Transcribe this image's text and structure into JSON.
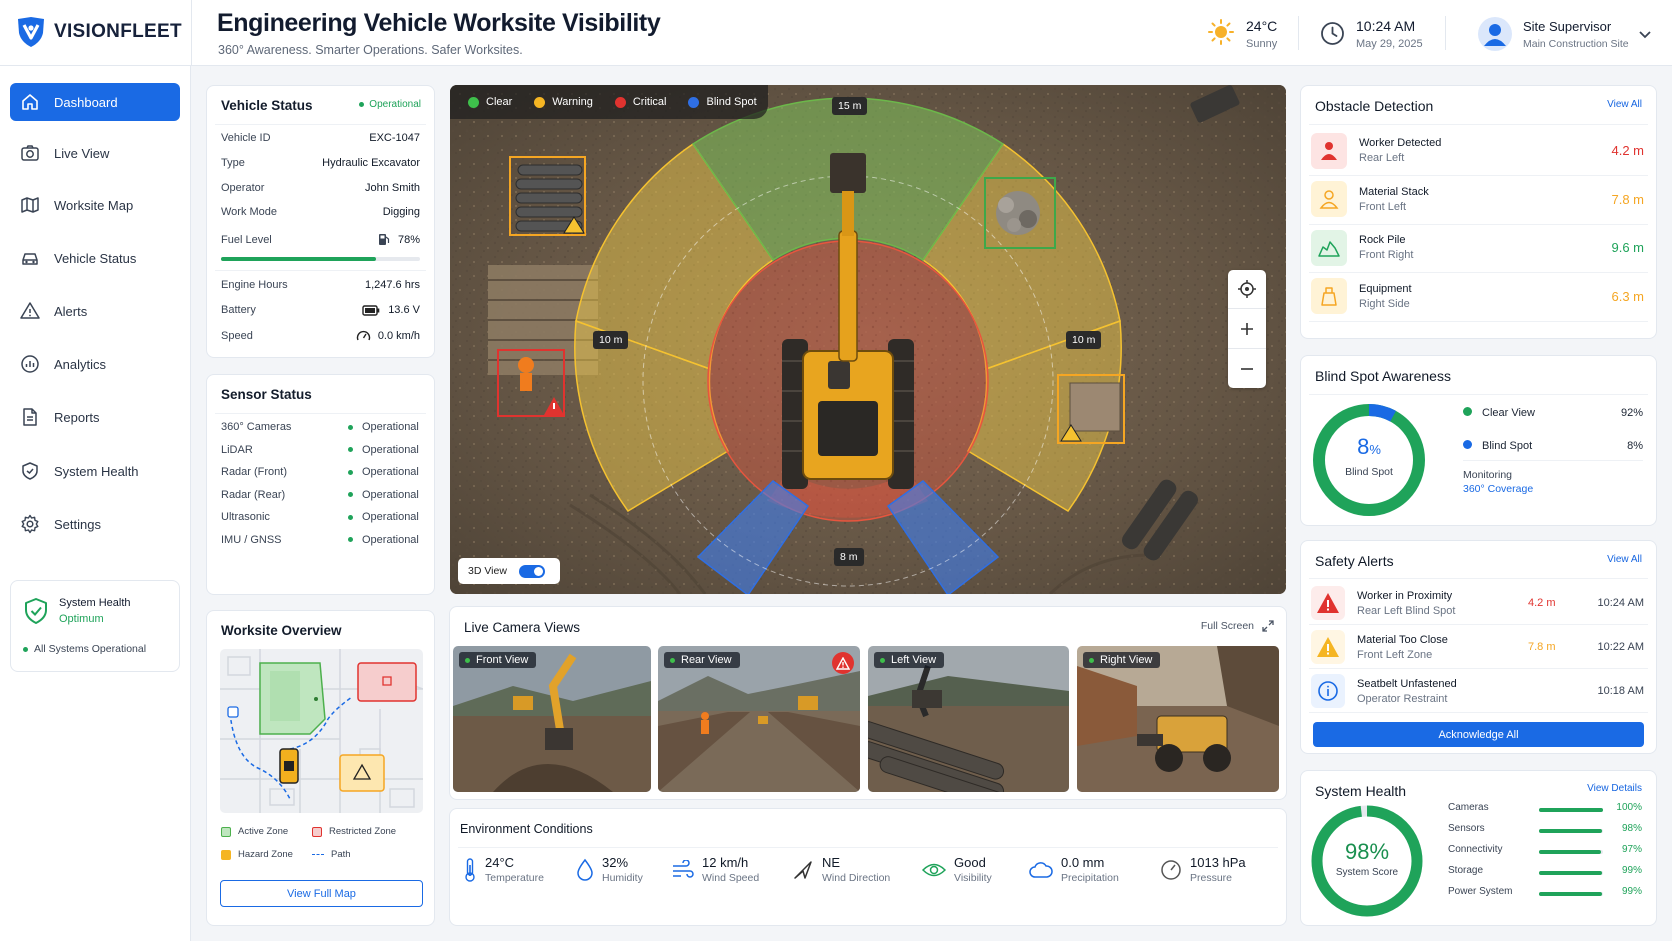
{
  "brand": {
    "name": "VISIONFLEET"
  },
  "header": {
    "title": "Engineering Vehicle Worksite Visibility",
    "subtitle": "360° Awareness. Smarter Operations. Safer Worksites.",
    "weather_temp": "24°C",
    "weather_desc": "Sunny",
    "time": "10:24 AM",
    "date": "May 29, 2025",
    "user_role": "Site Supervisor",
    "user_site": "Main Construction Site"
  },
  "nav": [
    {
      "label": "Dashboard",
      "icon": "home-icon",
      "active": true
    },
    {
      "label": "Live View",
      "icon": "camera-icon"
    },
    {
      "label": "Worksite Map",
      "icon": "map-icon"
    },
    {
      "label": "Vehicle Status",
      "icon": "car-icon"
    },
    {
      "label": "Alerts",
      "icon": "warning-icon"
    },
    {
      "label": "Analytics",
      "icon": "chart-icon"
    },
    {
      "label": "Reports",
      "icon": "document-icon"
    },
    {
      "label": "System Health",
      "icon": "shield-icon"
    },
    {
      "label": "Settings",
      "icon": "gear-icon"
    }
  ],
  "side_health": {
    "title": "System Health",
    "status": "Optimum",
    "note": "All Systems Operational"
  },
  "vehicle": {
    "title": "Vehicle Status",
    "status": "Operational",
    "rows": [
      {
        "k": "Vehicle ID",
        "v": "EXC-1047"
      },
      {
        "k": "Type",
        "v": "Hydraulic Excavator"
      },
      {
        "k": "Operator",
        "v": "John Smith"
      },
      {
        "k": "Work Mode",
        "v": "Digging"
      }
    ],
    "fuel_label": "Fuel Level",
    "fuel_value": "78%",
    "fuel_fraction": 0.78,
    "rows2": [
      {
        "k": "Engine Hours",
        "v": "1,247.6 hrs"
      },
      {
        "k": "Battery",
        "v": "13.6  V"
      },
      {
        "k": "Speed",
        "v": "0.0 km/h"
      }
    ]
  },
  "sensors": {
    "title": "Sensor Status",
    "items": [
      {
        "name": "360° Cameras",
        "status": "Operational"
      },
      {
        "name": "LiDAR",
        "status": "Operational"
      },
      {
        "name": "Radar (Front)",
        "status": "Operational"
      },
      {
        "name": "Radar (Rear)",
        "status": "Operational"
      },
      {
        "name": "Ultrasonic",
        "status": "Operational"
      },
      {
        "name": "IMU / GNSS",
        "status": "Operational"
      }
    ]
  },
  "overview": {
    "title": "Worksite Overview",
    "legend": [
      "Active Zone",
      "Restricted Zone",
      "Hazard Zone",
      "Path"
    ],
    "button": "View Full Map"
  },
  "mainview": {
    "legend": [
      "Clear",
      "Warning",
      "Critical",
      "Blind Spot"
    ],
    "dist_top": "15 m",
    "dist_left": "10 m",
    "dist_right": "10 m",
    "dist_bottom": "8 m",
    "toggle_label": "3D View",
    "toggle_on": true
  },
  "cameras": {
    "title": "Live Camera Views",
    "fullscreen": "Full Screen",
    "tiles": [
      "Front View",
      "Rear View",
      "Left View",
      "Right View"
    ]
  },
  "environment": {
    "title": "Environment Conditions",
    "items": [
      {
        "value": "24°C",
        "label": "Temperature"
      },
      {
        "value": "32%",
        "label": "Humidity"
      },
      {
        "value": "12 km/h",
        "label": "Wind Speed"
      },
      {
        "value": "NE",
        "label": "Wind Direction"
      },
      {
        "value": "Good",
        "label": "Visibility"
      },
      {
        "value": "0.0 mm",
        "label": "Precipitation"
      },
      {
        "value": "1013 hPa",
        "label": "Pressure"
      }
    ]
  },
  "obstacles": {
    "title": "Obstacle Detection",
    "link": "View All",
    "items": [
      {
        "name": "Worker Detected",
        "loc": "Rear Left",
        "dist": "4.2 m",
        "level": "critical"
      },
      {
        "name": "Material Stack",
        "loc": "Front Left",
        "dist": "7.8 m",
        "level": "warning"
      },
      {
        "name": "Rock Pile",
        "loc": "Front Right",
        "dist": "9.6 m",
        "level": "clear"
      },
      {
        "name": "Equipment",
        "loc": "Right Side",
        "dist": "6.3 m",
        "level": "warning"
      }
    ]
  },
  "blindspot": {
    "title": "Blind Spot Awareness",
    "percent": "8",
    "unit": "%",
    "caption": "Blind Spot",
    "blind_fraction": 0.08,
    "legend": [
      {
        "label": "Clear View",
        "value": "92%"
      },
      {
        "label": "Blind Spot",
        "value": "8%"
      }
    ],
    "monitor_label": "Monitoring",
    "monitor_value": "360° Coverage"
  },
  "alerts": {
    "title": "Safety Alerts",
    "link": "View All",
    "items": [
      {
        "name": "Worker in Proximity",
        "detail": "Rear Left Blind Spot",
        "dist": "4.2 m",
        "time": "10:24 AM",
        "level": "critical"
      },
      {
        "name": "Material Too Close",
        "detail": "Front Left Zone",
        "dist": "7.8 m",
        "time": "10:22 AM",
        "level": "warning"
      },
      {
        "name": "Seatbelt Unfastened",
        "detail": "Operator Restraint",
        "dist": "",
        "time": "10:18 AM",
        "level": "info"
      }
    ],
    "button": "Acknowledge All"
  },
  "syshealth": {
    "title": "System Health",
    "link": "View Details",
    "score": "98%",
    "score_label": "System Score",
    "score_fraction": 0.98,
    "items": [
      {
        "name": "Cameras",
        "value": "100%",
        "fraction": 1.0
      },
      {
        "name": "Sensors",
        "value": "98%",
        "fraction": 0.98
      },
      {
        "name": "Connectivity",
        "value": "97%",
        "fraction": 0.97
      },
      {
        "name": "Storage",
        "value": "99%",
        "fraction": 0.99
      },
      {
        "name": "Power System",
        "value": "99%",
        "fraction": 0.99
      }
    ]
  },
  "colors": {
    "accent": "#1a6ae4",
    "clear": "#1fa35a",
    "warning": "#f5a623",
    "critical": "#e0332f",
    "blind": "#2f6fe4"
  }
}
